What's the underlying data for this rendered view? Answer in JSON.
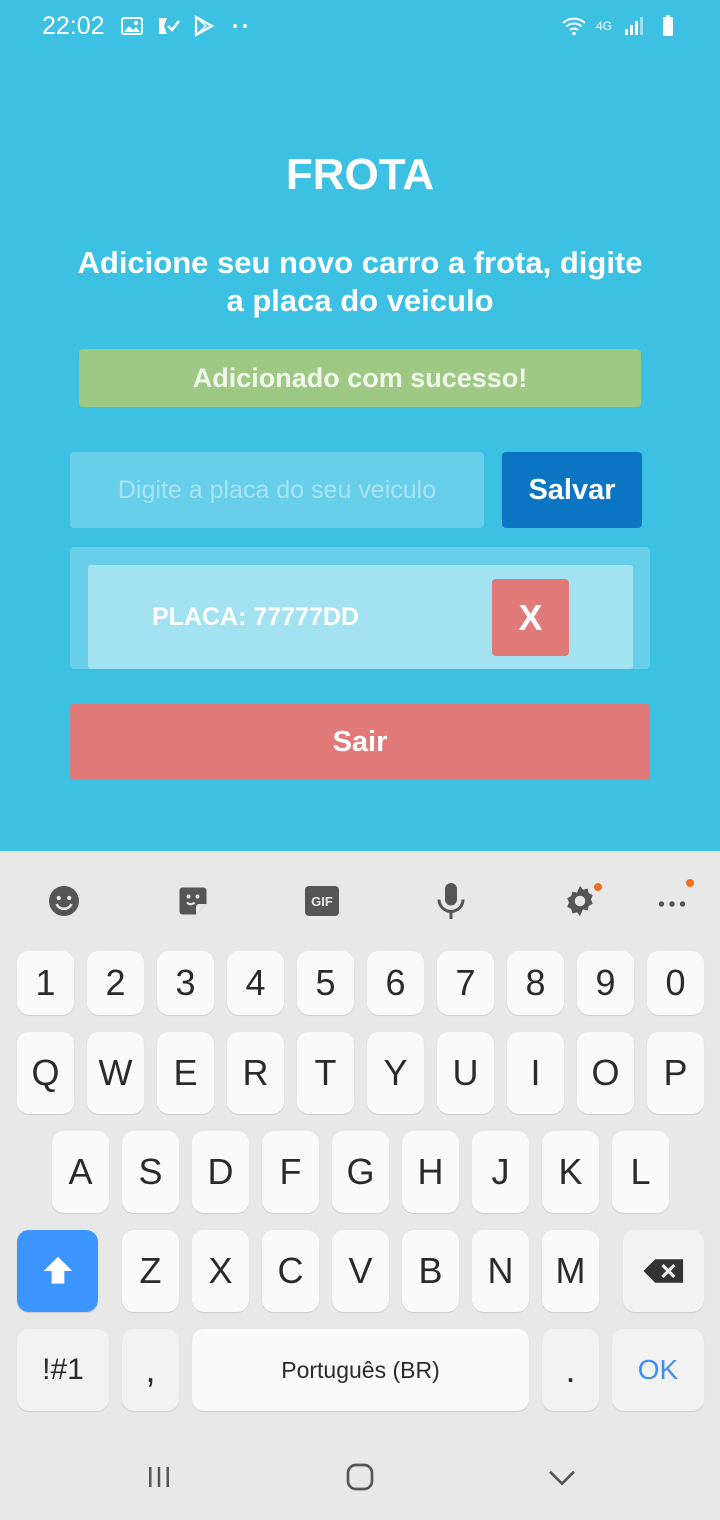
{
  "status_bar": {
    "time": "22:02",
    "left_icons": [
      "image-icon",
      "check-flag-icon",
      "play-store-icon",
      "more-dots-icon"
    ],
    "right_icons": [
      "wifi-icon",
      "4g-icon",
      "signal-icon",
      "battery-icon"
    ],
    "network_label": "4G"
  },
  "app": {
    "title": "FROTA",
    "subtitle": "Adicione seu novo carro a frota, digite a placa do veiculo",
    "success_message": "Adicionado com sucesso!",
    "input": {
      "placeholder": "Digite a placa do seu veiculo",
      "value": ""
    },
    "save_label": "Salvar",
    "vehicles": [
      {
        "label": "PLACA: 77777DD",
        "delete_label": "X"
      }
    ],
    "exit_label": "Sair",
    "colors": {
      "background": "#3cc1e3",
      "success": "#9ec985",
      "primary": "#0a75c2",
      "danger": "#e07b79"
    }
  },
  "keyboard": {
    "toolbar": [
      "emoji-icon",
      "sticker-icon",
      "gif-icon",
      "microphone-icon",
      "settings-icon",
      "more-icon"
    ],
    "gif_label": "GIF",
    "row_numbers": [
      "1",
      "2",
      "3",
      "4",
      "5",
      "6",
      "7",
      "8",
      "9",
      "0"
    ],
    "row_1": [
      "Q",
      "W",
      "E",
      "R",
      "T",
      "Y",
      "U",
      "I",
      "O",
      "P"
    ],
    "row_2": [
      "A",
      "S",
      "D",
      "F",
      "G",
      "H",
      "J",
      "K",
      "L"
    ],
    "row_3": [
      "Z",
      "X",
      "C",
      "V",
      "B",
      "N",
      "M"
    ],
    "symbols_label": "!#1",
    "comma_label": ",",
    "space_label": "Português (BR)",
    "period_label": ".",
    "ok_label": "OK"
  },
  "nav_bar": {
    "buttons": [
      "recent-apps-icon",
      "home-icon",
      "back-icon"
    ]
  }
}
